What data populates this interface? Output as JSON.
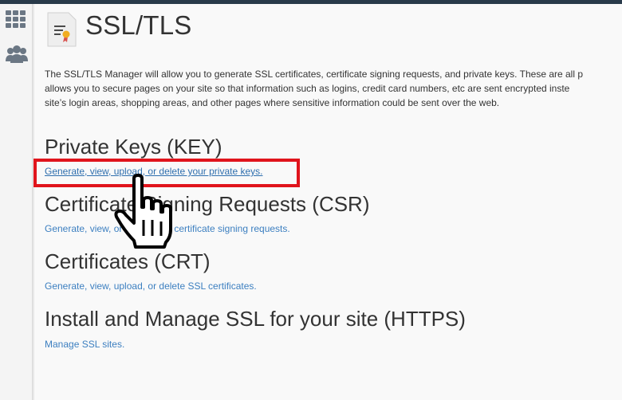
{
  "sidebar": {
    "items": [
      {
        "icon": "grid-icon",
        "label": ""
      },
      {
        "icon": "users-icon",
        "label": ""
      }
    ]
  },
  "page": {
    "title": "SSL/TLS",
    "icon": "certificate-icon"
  },
  "description_lines": [
    "The SSL/TLS Manager will allow you to generate SSL certificates, certificate signing requests, and private keys. These are all p",
    "allows you to secure pages on your site so that information such as logins, credit card numbers, etc are sent encrypted inste",
    "site’s login areas, shopping areas, and other pages where sensitive information could be sent over the web."
  ],
  "sections": [
    {
      "title": "Private Keys (KEY)",
      "link": "Generate, view, upload, or delete your private keys."
    },
    {
      "title": "Certificate Signing Requests (CSR)",
      "link": "Generate, view, or delete SSL certificate signing requests."
    },
    {
      "title": "Certificates (CRT)",
      "link": "Generate, view, upload, or delete SSL certificates."
    },
    {
      "title": "Install and Manage SSL for your site (HTTPS)",
      "link": "Manage SSL sites."
    }
  ],
  "colors": {
    "link": "#3c7fc0",
    "highlight": "#e0141c",
    "topbar": "#293a4a"
  },
  "overlay": {
    "highlight_target": "sections.0.link",
    "cursor": "hand-pointer-icon"
  }
}
